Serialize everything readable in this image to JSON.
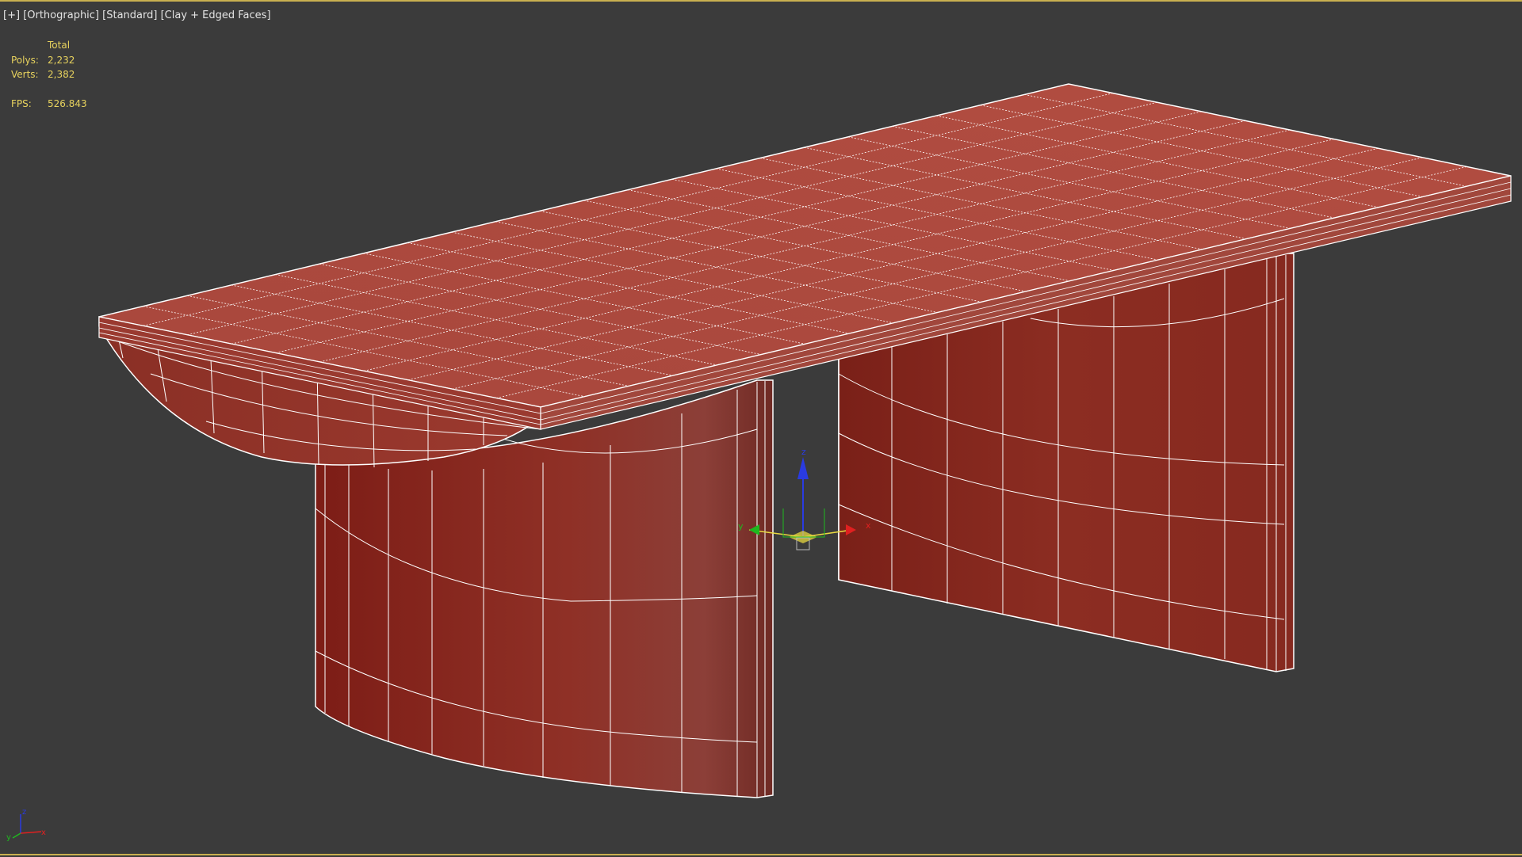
{
  "viewport": {
    "label_parts": [
      "[+]",
      "[Orthographic]",
      "[Standard]",
      "[Clay + Edged Faces]"
    ],
    "stats": {
      "header": "Total",
      "polys_label": "Polys:",
      "polys_value": "2,232",
      "verts_label": "Verts:",
      "verts_value": "2,382",
      "fps_label": "FPS:",
      "fps_value": "526.843"
    },
    "gizmo": {
      "x_label": "x",
      "y_label": "y",
      "z_label": "z"
    },
    "mini_axis": {
      "x_label": "x",
      "y_label": "y",
      "z_label": "z"
    }
  },
  "colors": {
    "background": "#3b3b3b",
    "frame": "#c9b050",
    "stats_text": "#e8d35e",
    "clay_red": "#9e3a30",
    "edge": "#ffffff",
    "axis_x": "#e02020",
    "axis_y": "#1fb81f",
    "axis_z": "#2a3be0"
  }
}
